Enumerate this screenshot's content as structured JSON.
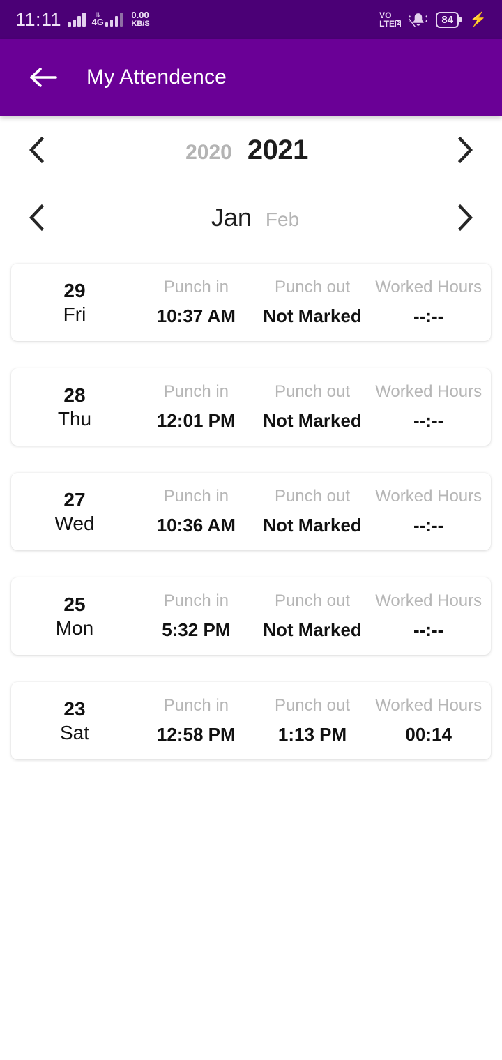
{
  "status_bar": {
    "time": "11:11",
    "network_updown": "↕",
    "network_type": "4G",
    "data_speed_value": "0.00",
    "data_speed_unit": "KB/S",
    "volte_line1": "VO",
    "volte_line2": "LTE",
    "volte_sim": "2",
    "battery_percent": "84",
    "charging_icon": "bolt-icon",
    "mute_icon": "bell-muted-icon",
    "signal_icon": "signal-bars-icon",
    "background": "#4b0076"
  },
  "app_bar": {
    "back_icon": "arrow-left-icon",
    "title": "My Attendence",
    "background": "#6a0096"
  },
  "year_selector": {
    "prev_icon": "chevron-left-icon",
    "next_icon": "chevron-right-icon",
    "previous_year": "2020",
    "selected_year": "2021"
  },
  "month_selector": {
    "prev_icon": "chevron-left-icon",
    "next_icon": "chevron-right-icon",
    "selected_month": "Jan",
    "next_month": "Feb"
  },
  "columns": {
    "punch_in": "Punch in",
    "punch_out": "Punch out",
    "worked_hours": "Worked Hours"
  },
  "attendance": [
    {
      "date": "29",
      "day": "Fri",
      "punch_in": "10:37 AM",
      "punch_out": "Not Marked",
      "worked_hours": "--:--"
    },
    {
      "date": "28",
      "day": "Thu",
      "punch_in": "12:01 PM",
      "punch_out": "Not Marked",
      "worked_hours": "--:--"
    },
    {
      "date": "27",
      "day": "Wed",
      "punch_in": "10:36 AM",
      "punch_out": "Not Marked",
      "worked_hours": "--:--"
    },
    {
      "date": "25",
      "day": "Mon",
      "punch_in": "5:32 PM",
      "punch_out": "Not Marked",
      "worked_hours": "--:--"
    },
    {
      "date": "23",
      "day": "Sat",
      "punch_in": "12:58 PM",
      "punch_out": "1:13 PM",
      "worked_hours": "00:14"
    }
  ]
}
